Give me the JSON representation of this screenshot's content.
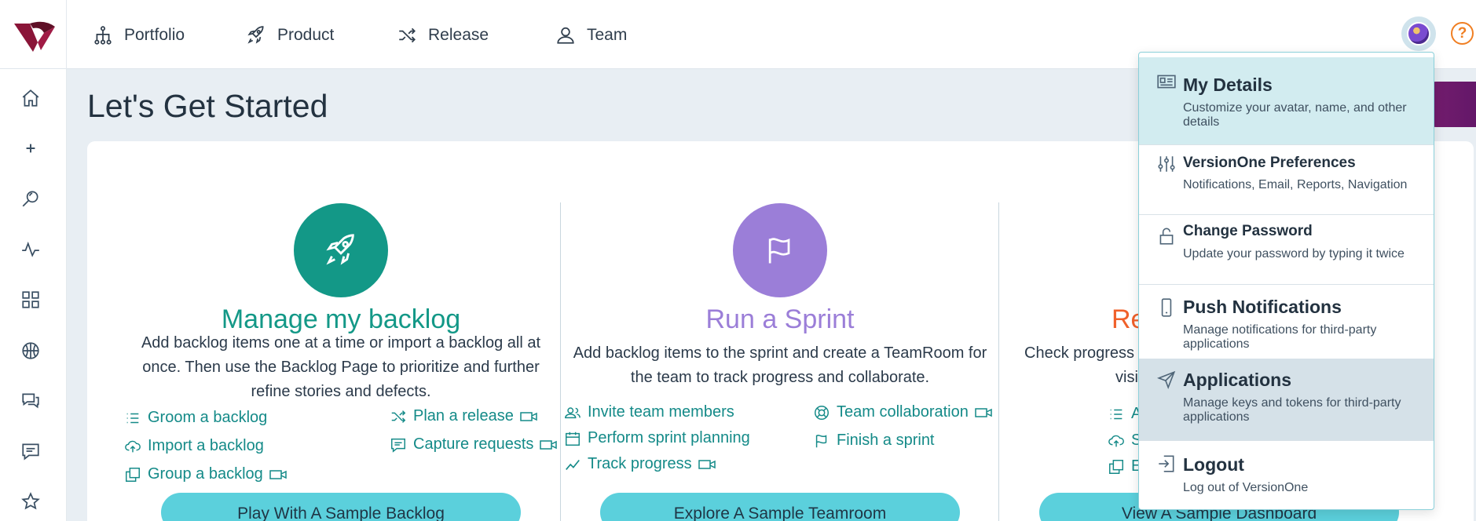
{
  "nav": {
    "items": [
      {
        "label": "Portfolio",
        "icon": "hierarchy-icon"
      },
      {
        "label": "Product",
        "icon": "rocket-icon"
      },
      {
        "label": "Release",
        "icon": "shuffle-icon"
      },
      {
        "label": "Team",
        "icon": "user-icon"
      }
    ],
    "help_glyph": "?"
  },
  "sidebar": {
    "icons": [
      "home-icon",
      "plus-icon",
      "search-icon",
      "activity-icon",
      "grid-icon",
      "basketball-icon",
      "chat-bubbles-icon",
      "message-icon",
      "star-icon"
    ]
  },
  "page": {
    "title": "Let's Get Started"
  },
  "sections": [
    {
      "title": "Manage my backlog",
      "color": "#139887",
      "description": "Add backlog items one at a time or import a backlog all at once. Then use the Backlog Page to prioritize and further refine stories and defects.",
      "links": [
        "Groom a backlog",
        "Import a backlog",
        "Group a backlog",
        "Plan a release",
        "Capture requests"
      ],
      "button": "Play With A Sample Backlog"
    },
    {
      "title": "Run a Sprint",
      "color": "#9b7ed8",
      "description": "Add backlog items to the sprint and create a TeamRoom for the team to track progress and collaborate.",
      "links": [
        "Invite team members",
        "Perform sprint planning",
        "Track progress",
        "Team collaboration",
        "Finish a sprint"
      ],
      "button": "Explore A Sample Teamroom"
    },
    {
      "title": "Re",
      "color": "#f0602a",
      "description_lines": [
        "Check progress o",
        "visi"
      ],
      "links": [
        "A",
        "S",
        "E"
      ],
      "button": "View A Sample Dashboard"
    }
  ],
  "menu": {
    "items": [
      {
        "title": "My Details",
        "desc": "Customize your avatar, name, and other details",
        "icon": "id-card-icon",
        "highlight": "#d2ecf0"
      },
      {
        "title": "VersionOne Preferences",
        "desc": "Notifications, Email, Reports, Navigation",
        "icon": "sliders-icon"
      },
      {
        "title": "Change Password",
        "desc": "Update your password by typing it twice",
        "icon": "lock-icon"
      },
      {
        "title": "Push Notifications",
        "desc": "Manage notifications for third-party applications",
        "icon": "phone-icon"
      },
      {
        "title": "Applications",
        "desc": "Manage keys and tokens for third-party applications",
        "icon": "send-icon",
        "highlight": "#d5e1e8"
      },
      {
        "title": "Logout",
        "desc": "Log out of VersionOne",
        "icon": "logout-icon"
      }
    ]
  }
}
